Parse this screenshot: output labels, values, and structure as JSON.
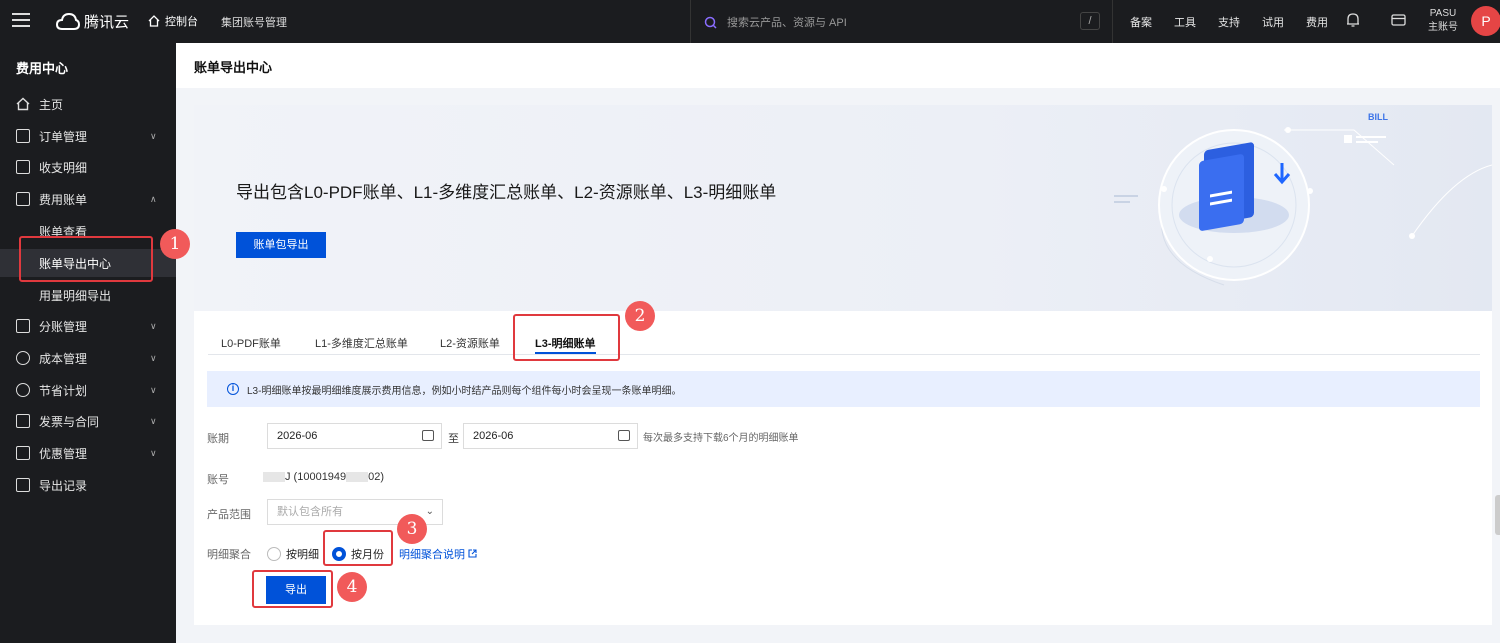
{
  "topbar": {
    "brand": "腾讯云",
    "console": "控制台",
    "org": "集团账号管理",
    "search_placeholder": "搜索云产品、资源与 API",
    "slash": "/",
    "nav": [
      "备案",
      "工具",
      "支持",
      "试用",
      "费用"
    ],
    "user_name": "PASU",
    "user_role": "主账号",
    "avatar": "P"
  },
  "sidebar": {
    "title": "费用中心",
    "items": [
      {
        "label": "主页",
        "icon": "home-icon"
      },
      {
        "label": "订单管理",
        "icon": "order-icon",
        "chevron": "∨"
      },
      {
        "label": "收支明细",
        "icon": "ledger-icon"
      },
      {
        "label": "费用账单",
        "icon": "bill-icon",
        "chevron": "∧"
      },
      {
        "label": "账单查看"
      },
      {
        "label": "账单导出中心"
      },
      {
        "label": "用量明细导出"
      },
      {
        "label": "分账管理",
        "icon": "split-icon",
        "chevron": "∨"
      },
      {
        "label": "成本管理",
        "icon": "cost-icon",
        "chevron": "∨"
      },
      {
        "label": "节省计划",
        "icon": "plan-icon",
        "chevron": "∨"
      },
      {
        "label": "发票与合同",
        "icon": "invoice-icon",
        "chevron": "∨"
      },
      {
        "label": "优惠管理",
        "icon": "discount-icon",
        "chevron": "∨"
      },
      {
        "label": "导出记录",
        "icon": "export-record-icon"
      }
    ]
  },
  "header": {
    "title": "账单导出中心"
  },
  "banner": {
    "text": "导出包含L0-PDF账单、L1-多维度汇总账单、L2-资源账单、L3-明细账单",
    "button": "账单包导出",
    "bill_label": "BILL"
  },
  "tabs": [
    "L0-PDF账单",
    "L1-多维度汇总账单",
    "L2-资源账单",
    "L3-明细账单"
  ],
  "info": "L3-明细账单按最明细维度展示费用信息，例如小时结产品则每个组件每小时会呈现一条账单明细。",
  "form": {
    "period_label": "账期",
    "start": "2026-06",
    "to": "至",
    "end": "2026-06",
    "period_hint": "每次最多支持下载6个月的明细账单",
    "account_label": "账号",
    "account_a": "J (10001949",
    "account_b": "02)",
    "scope_label": "产品范围",
    "scope_placeholder": "默认包含所有",
    "agg_label": "明细聚合",
    "opt_detail": "按明细",
    "opt_month": "按月份",
    "agg_link": "明细聚合说明",
    "export": "导出"
  },
  "markers": [
    "1",
    "2",
    "3",
    "4"
  ]
}
